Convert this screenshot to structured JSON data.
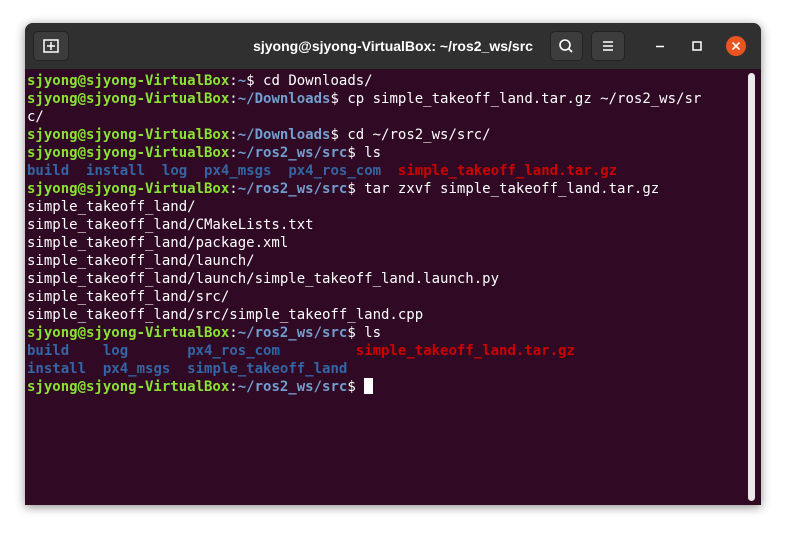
{
  "window": {
    "title": "sjyong@sjyong-VirtualBox: ~/ros2_ws/src",
    "buttons": {
      "new_tab_icon": "new-tab-icon",
      "search_icon": "search-icon",
      "menu_icon": "hamburger-menu-icon",
      "minimize_icon": "minimize-icon",
      "maximize_icon": "maximize-icon",
      "close_icon": "close-icon"
    },
    "colors": {
      "close_accent": "#e95420",
      "titlebar": "#303030",
      "terminal_bg": "#300a24"
    }
  },
  "terminal": {
    "colors": {
      "prompt_user": "#8ae234",
      "prompt_path": "#729fcf",
      "directory": "#3465a4",
      "archive": "#cc0000",
      "text": "#ffffff"
    },
    "lines": [
      {
        "user": "sjyong@sjyong-VirtualBox",
        "colon": ":",
        "path": "~",
        "sigil": "$",
        "cmd": " cd Downloads/"
      },
      {
        "user": "sjyong@sjyong-VirtualBox",
        "colon": ":",
        "path": "~/Downloads",
        "sigil": "$",
        "cmd": " cp simple_takeoff_land.tar.gz ~/ros2_ws/sr"
      },
      {
        "text": "c/"
      },
      {
        "user": "sjyong@sjyong-VirtualBox",
        "colon": ":",
        "path": "~/Downloads",
        "sigil": "$",
        "cmd": " cd ~/ros2_ws/src/"
      },
      {
        "user": "sjyong@sjyong-VirtualBox",
        "colon": ":",
        "path": "~/ros2_ws/src",
        "sigil": "$",
        "cmd": " ls"
      },
      {
        "ls": [
          {
            "name": "build",
            "kind": "dir"
          },
          {
            "name": "install",
            "kind": "dir"
          },
          {
            "name": "log",
            "kind": "dir"
          },
          {
            "name": "px4_msgs",
            "kind": "dir"
          },
          {
            "name": "px4_ros_com",
            "kind": "dir"
          },
          {
            "name": "simple_takeoff_land.tar.gz",
            "kind": "arc"
          }
        ]
      },
      {
        "user": "sjyong@sjyong-VirtualBox",
        "colon": ":",
        "path": "~/ros2_ws/src",
        "sigil": "$",
        "cmd": " tar zxvf simple_takeoff_land.tar.gz"
      },
      {
        "text": "simple_takeoff_land/"
      },
      {
        "text": "simple_takeoff_land/CMakeLists.txt"
      },
      {
        "text": "simple_takeoff_land/package.xml"
      },
      {
        "text": "simple_takeoff_land/launch/"
      },
      {
        "text": "simple_takeoff_land/launch/simple_takeoff_land.launch.py"
      },
      {
        "text": "simple_takeoff_land/src/"
      },
      {
        "text": "simple_takeoff_land/src/simple_takeoff_land.cpp"
      },
      {
        "user": "sjyong@sjyong-VirtualBox",
        "colon": ":",
        "path": "~/ros2_ws/src",
        "sigil": "$",
        "cmd": " ls"
      },
      {
        "ls": [
          {
            "name": "build",
            "kind": "dir"
          },
          {
            "name": "log",
            "kind": "dir"
          },
          {
            "name": "px4_ros_com",
            "kind": "dir"
          },
          {
            "name": "simple_takeoff_land.tar.gz",
            "kind": "arc"
          }
        ]
      },
      {
        "ls": [
          {
            "name": "install",
            "kind": "dir"
          },
          {
            "name": "px4_msgs",
            "kind": "dir"
          },
          {
            "name": "simple_takeoff_land",
            "kind": "dir"
          }
        ]
      },
      {
        "user": "sjyong@sjyong-VirtualBox",
        "colon": ":",
        "path": "~/ros2_ws/src",
        "sigil": "$",
        "cmd": " ",
        "cursor": true
      }
    ]
  }
}
